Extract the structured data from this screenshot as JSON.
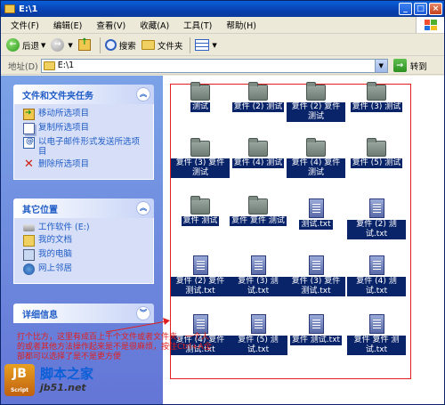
{
  "window": {
    "title": "E:\\1"
  },
  "menu": [
    "文件(F)",
    "编辑(E)",
    "查看(V)",
    "收藏(A)",
    "工具(T)",
    "帮助(H)"
  ],
  "toolbar": {
    "back": "后退",
    "search": "搜索",
    "folders": "文件夹"
  },
  "address": {
    "label": "地址(D)",
    "path": "E:\\1",
    "go": "转到"
  },
  "tasks_panel": {
    "title": "文件和文件夹任务",
    "items": [
      "移动所选项目",
      "复制所选项目",
      "以电子邮件形式发送所选项目",
      "删除所选项目"
    ]
  },
  "places_panel": {
    "title": "其它位置",
    "items": [
      "工作软件 (E:)",
      "我的文档",
      "我的电脑",
      "网上邻居"
    ]
  },
  "details_panel": {
    "title": "详细信息"
  },
  "files": [
    {
      "label": "测试",
      "type": "folder"
    },
    {
      "label": "复件 (2) 测试",
      "type": "folder"
    },
    {
      "label": "复件 (2) 复件 测试",
      "type": "folder"
    },
    {
      "label": "复件 (3) 测试",
      "type": "folder"
    },
    {
      "label": "复件 (3) 复件 测试",
      "type": "folder"
    },
    {
      "label": "复件 (4) 测试",
      "type": "folder"
    },
    {
      "label": "复件 (4) 复件 测试",
      "type": "folder"
    },
    {
      "label": "复件 (5) 测试",
      "type": "folder"
    },
    {
      "label": "复件 测试",
      "type": "folder"
    },
    {
      "label": "复件 复件 测试",
      "type": "folder"
    },
    {
      "label": "测试.txt",
      "type": "txt"
    },
    {
      "label": "复件 (2) 测试.txt",
      "type": "txt"
    },
    {
      "label": "复件 (2) 复件 测试.txt",
      "type": "txt"
    },
    {
      "label": "复件 (3) 测试.txt",
      "type": "txt"
    },
    {
      "label": "复件 (3) 复件 测试.txt",
      "type": "txt"
    },
    {
      "label": "复件 (4) 测试.txt",
      "type": "txt"
    },
    {
      "label": "复件 (4) 复件 测试.txt",
      "type": "txt"
    },
    {
      "label": "复件 (5) 测试.txt",
      "type": "txt"
    },
    {
      "label": "复件 测试.txt",
      "type": "txt"
    },
    {
      "label": "复件 复件 测试.txt",
      "type": "txt"
    }
  ],
  "annotation": "打个比方，这里有成百上千个文件或者文件夹，一个人的或者其他方法操作起来是不是很麻烦，按住Ctrl+A全部都可以选择了是不是更方便",
  "watermark": {
    "logo": "JB",
    "logo_sub": "Script",
    "name": "脚本之家",
    "url": "jb51.net"
  }
}
